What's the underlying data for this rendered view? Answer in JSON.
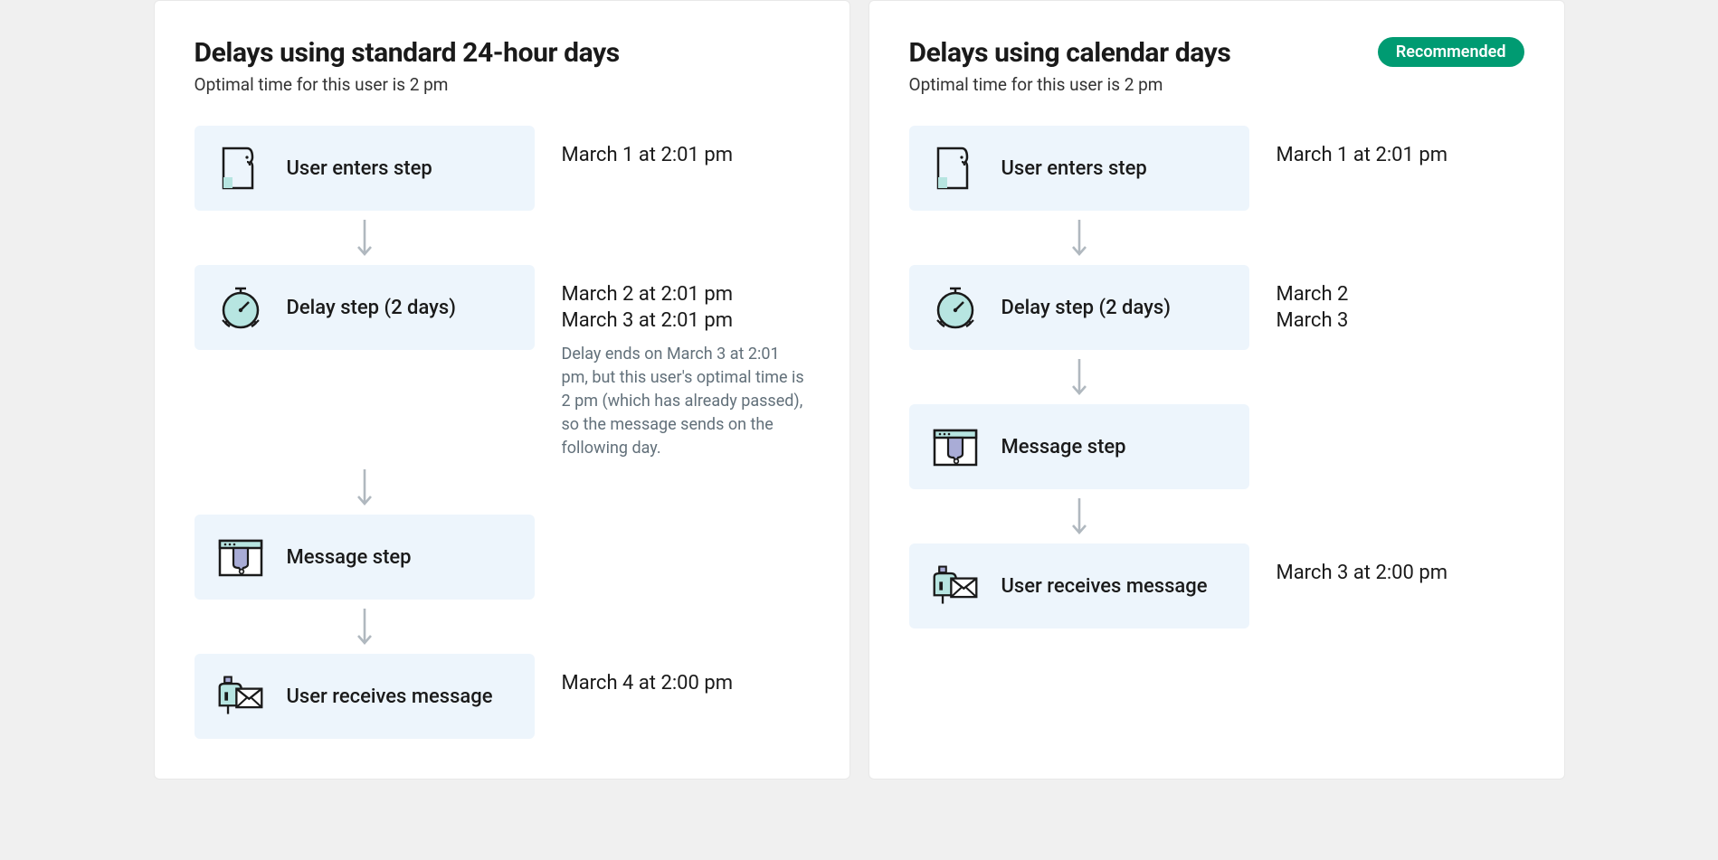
{
  "panels": [
    {
      "title": "Delays using standard 24-hour days",
      "subtitle": "Optimal time for this user is 2 pm",
      "badge": null,
      "steps": [
        {
          "icon": "user",
          "label": "User enters step",
          "timestamps": [
            "March 1 at 2:01 pm"
          ],
          "note": null
        },
        {
          "icon": "timer",
          "label": "Delay step (2 days)",
          "timestamps": [
            "March 2 at 2:01 pm",
            "March 3 at 2:01 pm"
          ],
          "note": "Delay ends on March 3 at 2:01 pm, but this user's optimal time is 2 pm (which has already passed), so the message sends on the following day."
        },
        {
          "icon": "message",
          "label": "Message step",
          "timestamps": [],
          "note": null
        },
        {
          "icon": "mailbox",
          "label": "User receives message",
          "timestamps": [
            "March 4 at 2:00 pm"
          ],
          "note": null
        }
      ]
    },
    {
      "title": "Delays using calendar days",
      "subtitle": "Optimal time for this user is 2 pm",
      "badge": "Recommended",
      "steps": [
        {
          "icon": "user",
          "label": "User enters step",
          "timestamps": [
            "March 1 at 2:01 pm"
          ],
          "note": null
        },
        {
          "icon": "timer",
          "label": "Delay step (2 days)",
          "timestamps": [
            "March 2",
            "March 3"
          ],
          "note": null
        },
        {
          "icon": "message",
          "label": "Message step",
          "timestamps": [],
          "note": null
        },
        {
          "icon": "mailbox",
          "label": "User receives message",
          "timestamps": [
            "March 3 at 2:00 pm"
          ],
          "note": null
        }
      ]
    }
  ]
}
